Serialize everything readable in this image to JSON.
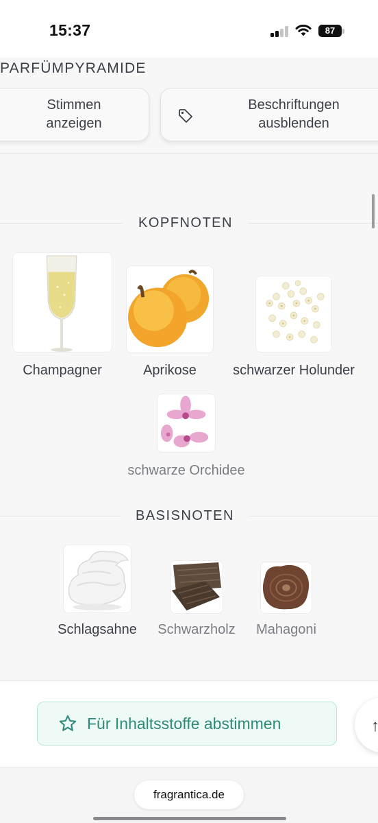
{
  "status_bar": {
    "time": "15:37",
    "battery": "87"
  },
  "pyramid_section": {
    "title": "PARFÜMPYRAMIDE",
    "show_votes_label": "Stimmen anzeigen",
    "hide_labels_label": "Beschriftungen ausblenden"
  },
  "top_notes": {
    "heading": "KOPFNOTEN",
    "items": [
      {
        "label": "Champagner",
        "icon": "champagne-glass"
      },
      {
        "label": "Aprikose",
        "icon": "apricot"
      },
      {
        "label": "schwarzer Holunder",
        "icon": "elderflower"
      },
      {
        "label": "schwarze Orchidee",
        "icon": "orchid"
      }
    ]
  },
  "base_notes": {
    "heading": "BASISNOTEN",
    "items": [
      {
        "label": "Schlagsahne",
        "icon": "whipped-cream"
      },
      {
        "label": "Schwarzholz",
        "icon": "dark-wood-planks"
      },
      {
        "label": "Mahagoni",
        "icon": "mahogany-wood-slice"
      }
    ]
  },
  "vote_button": {
    "label": "Für Inhaltsstoffe abstimmen",
    "icon": "star"
  },
  "browser": {
    "url": "fragrantica.de"
  },
  "colors": {
    "accent_teal": "#2f8a7a",
    "vote_bg": "#eefaf6",
    "vote_border": "#b9e6dc"
  }
}
